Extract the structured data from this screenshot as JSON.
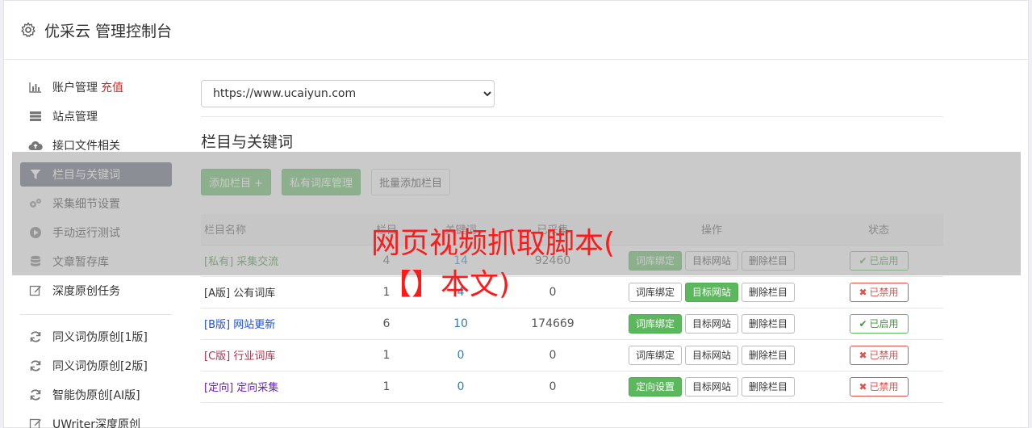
{
  "header": {
    "title": "优采云 管理控制台"
  },
  "sidebar": {
    "items": [
      {
        "label": "账户管理",
        "extra": "充值",
        "icon": "bar-chart-icon"
      },
      {
        "label": "站点管理",
        "icon": "server-icon"
      },
      {
        "label": "接口文件相关",
        "icon": "cloud-upload-icon"
      },
      {
        "label": "栏目与关键词",
        "icon": "filter-icon",
        "active": true
      },
      {
        "label": "采集细节设置",
        "icon": "cogs-icon"
      },
      {
        "label": "手动运行测试",
        "icon": "play-circle-icon"
      },
      {
        "label": "文章暂存库",
        "icon": "database-icon"
      },
      {
        "label": "深度原创任务",
        "icon": "edit-icon"
      },
      {
        "label": "同义词伪原创[1版]",
        "icon": "refresh-icon"
      },
      {
        "label": "同义词伪原创[2版]",
        "icon": "refresh-icon"
      },
      {
        "label": "智能伪原创[AI版]",
        "icon": "refresh-icon"
      },
      {
        "label": "UWriter深度原创",
        "icon": "edit-icon"
      }
    ]
  },
  "main": {
    "site_select": {
      "value": "https://www.ucaiyun.com",
      "options": [
        "https://www.ucaiyun.com"
      ]
    },
    "section_title": "栏目与关键词",
    "toolbar": {
      "add_column": "添加栏目 +",
      "private_lib": "私有词库管理",
      "batch_add": "批量添加栏目"
    },
    "table": {
      "headers": [
        "栏目名称",
        "栏目",
        "关键词",
        "已采集",
        "操作",
        "状态"
      ],
      "rows": [
        {
          "tag": "[私有]",
          "name": "采集交流",
          "cls": "c-private",
          "a": "4",
          "b": "14",
          "c": "92460",
          "bind_label": "词库绑定",
          "bind_green": true,
          "target_green": false,
          "status": "已启用",
          "on": true
        },
        {
          "tag": "[A版]",
          "name": "公有词库",
          "cls": "c-a",
          "a": "1",
          "b": "4",
          "c": "0",
          "bind_label": "词库绑定",
          "bind_green": false,
          "target_green": true,
          "status": "已禁用",
          "on": false
        },
        {
          "tag": "[B版]",
          "name": "网站更新",
          "cls": "c-b",
          "a": "6",
          "b": "10",
          "c": "174669",
          "bind_label": "词库绑定",
          "bind_green": true,
          "target_green": false,
          "status": "已启用",
          "on": true
        },
        {
          "tag": "[C版]",
          "name": "行业词库",
          "cls": "c-c",
          "a": "1",
          "b": "0",
          "c": "0",
          "bind_label": "词库绑定",
          "bind_green": false,
          "target_green": false,
          "status": "已禁用",
          "on": false
        },
        {
          "tag": "[定向]",
          "name": "定向采集",
          "cls": "c-d",
          "a": "1",
          "b": "0",
          "c": "0",
          "bind_label": "定向设置",
          "bind_green": true,
          "target_green": false,
          "status": "已禁用",
          "on": false
        }
      ],
      "target_label": "目标网站",
      "delete_label": "删除栏目"
    }
  },
  "watermark": {
    "line1": "网页视频抓取脚本(",
    "line2": "【】本文)"
  }
}
